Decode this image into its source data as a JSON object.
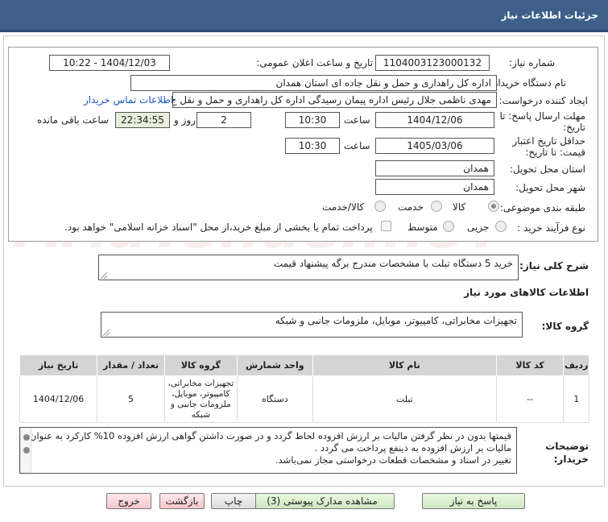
{
  "title": "جزئیات اطلاعات نیاز",
  "watermark": "AriaTender.neT",
  "need_number": {
    "label": "شماره نیاز:",
    "value": "1104003123000132"
  },
  "announce": {
    "label": "تاریخ و ساعت اعلان عمومی:",
    "value": "1404/12/03 - 10:22"
  },
  "buyer": {
    "label": "نام دستگاه خریدار:",
    "value": "اداره کل راهداری و حمل و نقل جاده ای استان همدان"
  },
  "creator": {
    "label": "ایجاد کننده درخواست:",
    "value": "مهدی ناظمی جلال رئیس اداره پیمان رسیدگی اداره کل راهداری و حمل و نقل ج",
    "contact_link": "اطلاعات تماس خریدار"
  },
  "deadline": {
    "label": "مهلت ارسال پاسخ: تا تاریخ:",
    "date": "1404/12/06",
    "time_label": "ساعت",
    "time": "10:30",
    "days": "2",
    "days_label": "روز و",
    "remaining": "22:34:55",
    "remaining_label": "ساعت باقی مانده"
  },
  "validity": {
    "label": "حداقل تاریخ اعتبار قیمت: تا تاریخ:",
    "date": "1405/03/06",
    "time_label": "ساعت",
    "time": "10:30"
  },
  "province": {
    "label": "استان محل تحویل:",
    "value": "همدان"
  },
  "city": {
    "label": "شهر محل تحویل:",
    "value": "همدان"
  },
  "category": {
    "label": "طبقه بندی موضوعی:",
    "options": [
      "کالا",
      "خدمت",
      "کالا/خدمت"
    ],
    "selected": "کالا"
  },
  "process": {
    "label": "نوع فرآیند خرید :",
    "options": [
      "جزیی",
      "متوسط"
    ],
    "note": "پرداخت تمام یا بخشی از مبلغ خرید،از محل \"اسناد خزانه اسلامی\" خواهد بود."
  },
  "summary": {
    "label": "شرح کلی نیاز:",
    "value": "خرید 5 دستگاه تبلت با مشخصات مندرج برگه پیشنهاد قیمت"
  },
  "goods_info_title": "اطلاعات کالاهای مورد نیاز",
  "goods_group": {
    "label": "گروه کالا:",
    "value": "تجهیزات مخابراتی، کامپیوتر، موبایل، ملزومات جانبی و شبکه"
  },
  "table": {
    "headers": [
      "ردیف",
      "کد کالا",
      "نام کالا",
      "واحد شمارش",
      "گروه کالا",
      "تعداد / مقدار",
      "تاریخ نیاز"
    ],
    "rows": [
      [
        "1",
        "--",
        "تبلت",
        "دستگاه",
        "تجهیزات مخابراتی، کامپیوتر، موبایل، ملزومات جانبی و شبکه",
        "5",
        "1404/12/06"
      ]
    ]
  },
  "notes": {
    "label": "توضیحات خریدار:",
    "line1": "قیمتها بدون در نظر گرفتن مالیات بر ارزش افزوده لحاظ گردد و در صورت داشتن گواهی ارزش افزوده  10% کارکرد به عنوان",
    "line2": "مالیات بر ارزش افزوده به ذینفع پرداخت می گردد .",
    "line3": "تغییر در اسناد و مشخصات قطعات درخواستی مجاز نمی‌باشد."
  },
  "buttons": {
    "reply": "پاسخ به نیاز",
    "docs": "مشاهده مدارک پیوستی (3)",
    "print": "چاپ",
    "back": "بازگشت",
    "exit": "خروج"
  }
}
